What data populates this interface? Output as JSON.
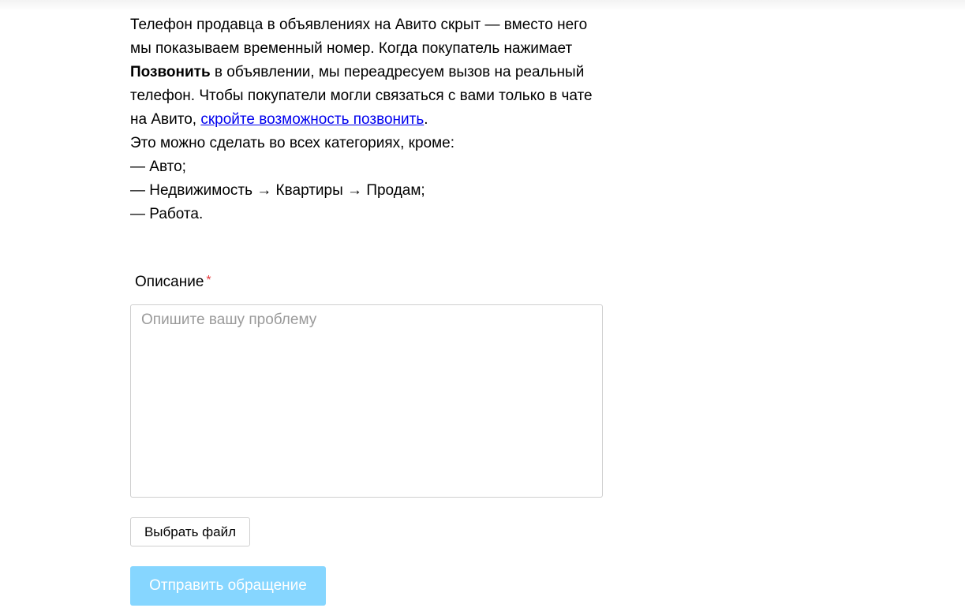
{
  "info": {
    "p1_before_bold": "Телефон продавца в объявлениях на Авито скрыт — вместо него мы показываем временный номер. Когда покупатель нажимает ",
    "p1_bold": "Позвонить",
    "p1_after_bold": " в объявлении, мы переадресуем вызов на реальный телефон. Чтобы покупатели могли связаться с вами только в чате на Авито, ",
    "p1_link": "скройте возможность позвонить",
    "p1_end": ".",
    "p2": "Это можно сделать во всех категориях, кроме:",
    "exceptions": [
      "— Авто;",
      "— Недвижимость → Квартиры → Продам;",
      "— Работа."
    ]
  },
  "form": {
    "description_label": "Описание",
    "required_mark": "*",
    "description_placeholder": "Опишите вашу проблему",
    "description_value": "",
    "file_button_label": "Выбрать файл",
    "submit_label": "Отправить обращение"
  },
  "colors": {
    "link": "#0000ee",
    "required": "#e5383b",
    "submit_bg": "#86d6ff",
    "submit_text": "#ffffff",
    "border": "#cfcfcf",
    "placeholder": "#9a9a9a"
  }
}
